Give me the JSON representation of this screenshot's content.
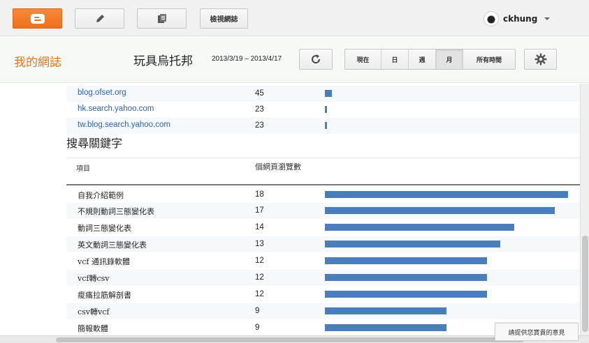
{
  "toolbar": {
    "view_blog_label": "檢視網誌",
    "username": "ckhung"
  },
  "header": {
    "my_blog": "我的網誌",
    "blog_name": "玩具烏托邦",
    "date_range": "2013/3/19 – 2013/4/17",
    "periods": [
      "現在",
      "日",
      "週",
      "月",
      "所有時間"
    ],
    "active_period": "月"
  },
  "referrers": [
    {
      "name": "blog.ofset.org",
      "views": "45",
      "fraction": 0.029
    },
    {
      "name": "hk.search.yahoo.com",
      "views": "23",
      "fraction": 0.008
    },
    {
      "name": "tw.blog.search.yahoo.com",
      "views": "23",
      "fraction": 0.008
    }
  ],
  "keywords": {
    "title": "搜尋關鍵字",
    "col_item": "項目",
    "col_views": "個網頁瀏覽數",
    "rows": [
      {
        "name": "自我介紹範例",
        "views": "18",
        "fraction": 1.0
      },
      {
        "name": "不規則動詞三態變化表",
        "views": "17",
        "fraction": 0.944
      },
      {
        "name": "動詞三態變化表",
        "views": "14",
        "fraction": 0.778
      },
      {
        "name": "英文動詞三態變化表",
        "views": "13",
        "fraction": 0.722
      },
      {
        "name": "vcf 通訊錄軟體",
        "views": "12",
        "fraction": 0.667
      },
      {
        "name": "vcf轉csv",
        "views": "12",
        "fraction": 0.667
      },
      {
        "name": "痠痛拉筋解剖書",
        "views": "12",
        "fraction": 0.667
      },
      {
        "name": "csv轉vcf",
        "views": "9",
        "fraction": 0.5
      },
      {
        "name": "簡報軟體",
        "views": "9",
        "fraction": 0.5
      }
    ]
  },
  "feedback_label": "請提供您寶貴的意見",
  "colors": {
    "accent": "#e8731c",
    "bar": "#4a7ebb",
    "link": "#2b62b3"
  }
}
